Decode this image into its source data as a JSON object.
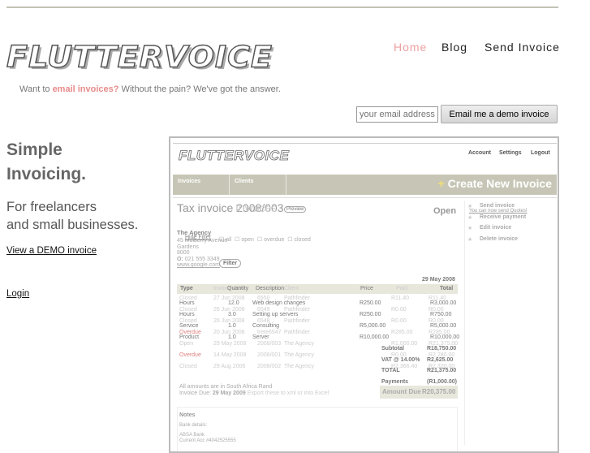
{
  "site": {
    "logo": "FLUTTERVOICE",
    "nav": [
      "Home",
      "Blog",
      "Send Invoice"
    ],
    "tagline_pre": "Want to ",
    "tagline_hl": "email invoices?",
    "tagline_post": " Without the pain? We've got the answer."
  },
  "demo_form": {
    "placeholder": "your email address",
    "button": "Email me a demo invoice"
  },
  "hero": {
    "title1": "Simple",
    "title2": "Invoicing.",
    "sub1": "For freelancers",
    "sub2": "and small businesses.",
    "demo_link": "View a DEMO invoice",
    "login": "Login"
  },
  "shot": {
    "logo": "FLUTTERVOICE",
    "top_nav": [
      "Account",
      "Settings",
      "Logout"
    ],
    "tabs": [
      "Invoices",
      "Clients"
    ],
    "create": "Create New Invoice",
    "title": "Tax invoice 2008/003",
    "title_bg": "Invoices",
    "preview": "Preview",
    "status": "Open",
    "client": {
      "name": "The Agency",
      "addr": [
        "45 Mulberry Avenue",
        "Gardens",
        "8000"
      ],
      "phone_label": "O:",
      "phone": "021 555 3349",
      "web": "www.google.com"
    },
    "filter": {
      "hide": "Hide Filter",
      "opts": [
        "all",
        "open",
        "overdue",
        "closed"
      ],
      "btn": "Filter"
    },
    "date": "29 May 2008",
    "headers": [
      "Type",
      "Quantity",
      "Description",
      "Price",
      "Total"
    ],
    "headers_bg": [
      "Invoice date",
      "Invoice",
      "Client",
      "Paid"
    ],
    "lines": [
      {
        "type": "Hours",
        "qty": "12.0",
        "desc": "Web design changes",
        "price": "R250.00",
        "total": "R3,000.00"
      },
      {
        "type": "Hours",
        "qty": "3.0",
        "desc": "Setting up servers",
        "price": "R250.00",
        "total": "R750.00"
      },
      {
        "type": "Service",
        "qty": "1.0",
        "desc": "Consulting",
        "price": "R5,000.00",
        "total": "R5,000.00"
      },
      {
        "type": "Product",
        "qty": "1.0",
        "desc": "Server",
        "price": "R10,000.00",
        "total": "R10,000.00"
      }
    ],
    "bg_rows": [
      {
        "status": "Closed",
        "date": "27 Jun 2008",
        "no": "6550",
        "client": "Pathfinder",
        "paid": "R11.40",
        "total": "R11.40"
      },
      {
        "status": "Closed",
        "date": "26 Jun 2008",
        "no": "6549",
        "client": "Pathfinder",
        "paid": "R0.00",
        "total": "R0.00"
      },
      {
        "status": "Closed",
        "date": "26 Jun 2008",
        "no": "6548",
        "client": "Pathfinder",
        "paid": "R0.00",
        "total": "R0.00"
      },
      {
        "status": "Overdue",
        "date": "20 Jun 2008",
        "no": "trete6547",
        "client": "Pathfinder",
        "paid": "R285.00",
        "total": "R285.00"
      },
      {
        "status": "Open",
        "date": "29 May 2008",
        "no": "2008/003",
        "client": "The Agency",
        "paid": "R1,000.00",
        "total": "R21,375.00"
      },
      {
        "status": "Overdue",
        "date": "14 May 2008",
        "no": "2008/001",
        "client": "The Agency",
        "paid": "R0.00",
        "total": "R2,280.00"
      },
      {
        "status": "Closed",
        "date": "29 Aug 2006",
        "no": "2008/002",
        "client": "The Agency",
        "paid": "R2,366.40",
        "total": "R2,320.00"
      }
    ],
    "totals": [
      {
        "l": "Subtotal",
        "v": "R18,750.00"
      },
      {
        "l": "VAT @ 14.00%",
        "v": "R2,625.00"
      },
      {
        "l": "TOTAL",
        "v": "R21,375.00"
      },
      {
        "l": "Payments",
        "v": "(R1,000.00)"
      }
    ],
    "amount_due_label": "Amount Due",
    "amount_due": "R20,375.00",
    "currency_note": "All amounts are in South Africa Rand",
    "due_label": "Invoice Due:",
    "due": "29 May 2009",
    "export": "Export these to xml or into Excel",
    "notes": {
      "title": "Notes",
      "l1": "Bank details:",
      "l2": "ABSA Bank",
      "l3": "Current Acc #4042525555"
    },
    "actions": [
      "Send invoice",
      "Receive payment",
      "Edit invoice",
      "Delete invoice"
    ],
    "quotes": "You can now send Quotes!"
  }
}
